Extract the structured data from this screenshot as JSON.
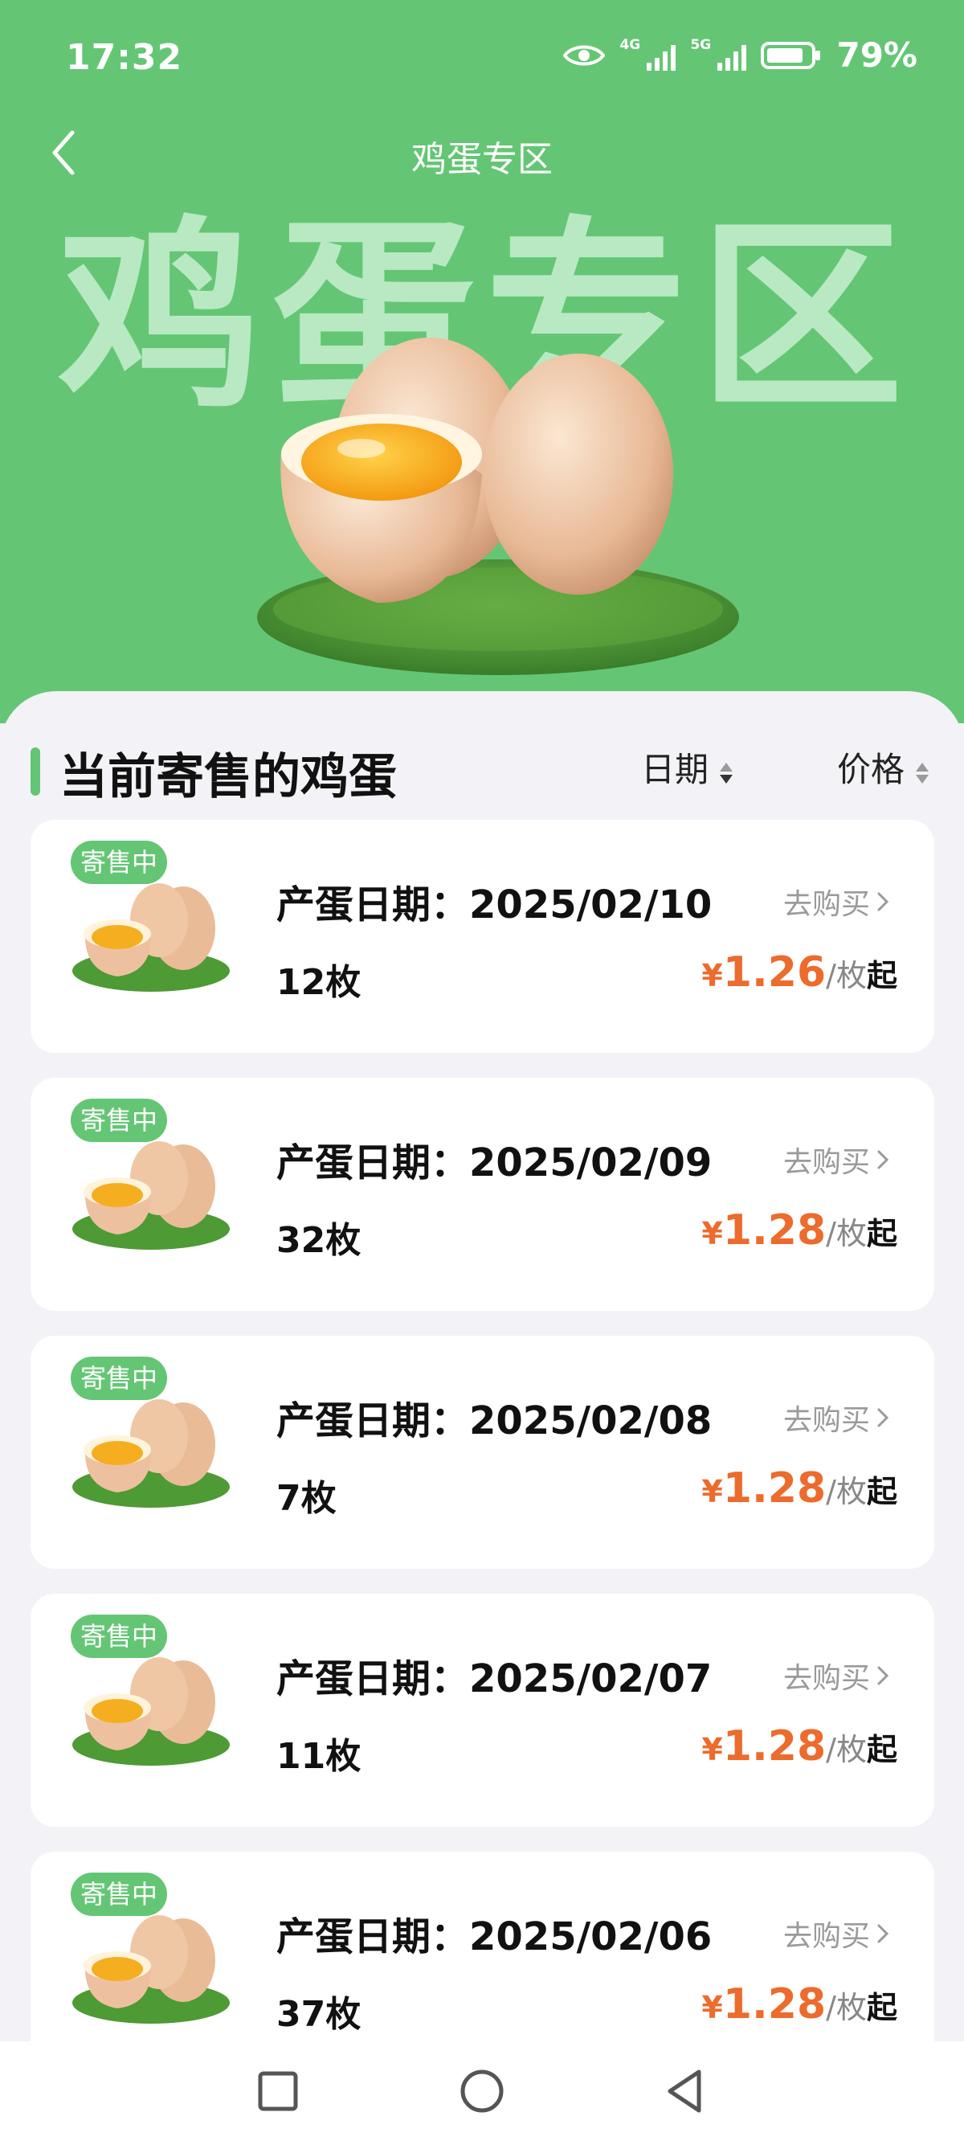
{
  "status_bar": {
    "time": "17:32",
    "signal1": "4G",
    "signal2": "5G",
    "battery": "79%",
    "icons": [
      "eye-icon",
      "signal-icon",
      "battery-icon"
    ]
  },
  "header": {
    "title": "鸡蛋专区",
    "hero_text": "鸡蛋专区"
  },
  "section": {
    "title": "当前寄售的鸡蛋",
    "sort_date": "日期",
    "sort_price": "价格"
  },
  "items": [
    {
      "badge": "寄售中",
      "date": "产蛋日期：2025/02/10",
      "count": "12枚",
      "buy": "去购买",
      "currency": "¥",
      "price": "1.26",
      "unit": "/枚",
      "suffix": "起"
    },
    {
      "badge": "寄售中",
      "date": "产蛋日期：2025/02/09",
      "count": "32枚",
      "buy": "去购买",
      "currency": "¥",
      "price": "1.28",
      "unit": "/枚",
      "suffix": "起"
    },
    {
      "badge": "寄售中",
      "date": "产蛋日期：2025/02/08",
      "count": "7枚",
      "buy": "去购买",
      "currency": "¥",
      "price": "1.28",
      "unit": "/枚",
      "suffix": "起"
    },
    {
      "badge": "寄售中",
      "date": "产蛋日期：2025/02/07",
      "count": "11枚",
      "buy": "去购买",
      "currency": "¥",
      "price": "1.28",
      "unit": "/枚",
      "suffix": "起"
    },
    {
      "badge": "寄售中",
      "date": "产蛋日期：2025/02/06",
      "count": "37枚",
      "buy": "去购买",
      "currency": "¥",
      "price": "1.28",
      "unit": "/枚",
      "suffix": "起"
    }
  ],
  "colors": {
    "brand_green": "#64c674",
    "price_orange": "#ec6b2d",
    "background": "#f3f3f7"
  }
}
